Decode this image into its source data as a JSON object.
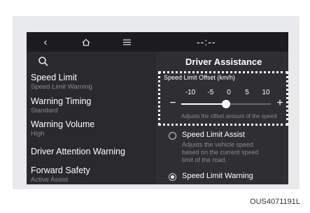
{
  "topbar": {
    "back_icon": "chevron-left-icon",
    "home_icon": "home-icon",
    "menu_icon": "menu-icon",
    "clock": "--:--"
  },
  "sidebar": {
    "search_icon": "search-icon",
    "items": [
      {
        "title": "Speed Limit",
        "subtitle": "Speed Limit Warning"
      },
      {
        "title": "Warning Timing",
        "subtitle": "Standard"
      },
      {
        "title": "Warning Volume",
        "subtitle": "High"
      },
      {
        "title": "Driver Attention Warning",
        "subtitle": ""
      },
      {
        "title": "Forward Safety",
        "subtitle": "Active Assist"
      }
    ]
  },
  "main": {
    "title": "Driver Assistance",
    "offset": {
      "label": "Speed Limit Offset (km/h)",
      "ticks": [
        "-10",
        "-5",
        "0",
        "5",
        "10"
      ],
      "value": 0,
      "min": -10,
      "max": 10,
      "minus": "−",
      "plus": "+",
      "description": "Adjusts the offset amount of the speed"
    },
    "options": [
      {
        "label": "Speed Limit Assist",
        "description": "Adjusts the vehicle speed based on the current speed limit of the road.",
        "selected": false
      },
      {
        "label": "Speed Limit Warning",
        "description": "",
        "selected": true
      }
    ]
  },
  "figure_code": "OUS4071191L"
}
